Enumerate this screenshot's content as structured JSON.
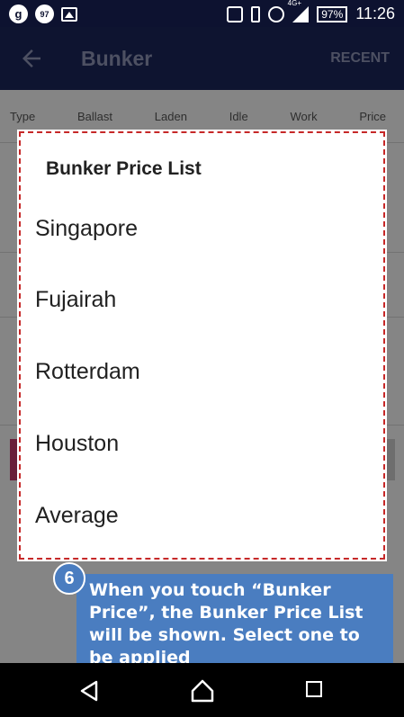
{
  "status_bar": {
    "left_icons": [
      "g-circle-icon",
      "notification-97-icon",
      "image-icon"
    ],
    "badge_g": "g",
    "badge_97": "97",
    "network": "4G+",
    "battery": "97%",
    "time": "11:26"
  },
  "app_bar": {
    "title": "Bunker",
    "recent_label": "RECENT"
  },
  "table_header": [
    "Type",
    "Ballast",
    "Laden",
    "Idle",
    "Work",
    "Price"
  ],
  "dialog": {
    "title": "Bunker Price List",
    "options": [
      "Singapore",
      "Fujairah",
      "Rotterdam",
      "Houston",
      "Average"
    ]
  },
  "callout": {
    "step": "6",
    "text": "When you touch “Bunker Price”, the Bunker Price List will be shown. Select one to be applied"
  },
  "colors": {
    "status_bar": "#0d1230",
    "app_bar": "#1a2558",
    "callout": "#4a7dc0",
    "dialog_border": "#c62828"
  }
}
